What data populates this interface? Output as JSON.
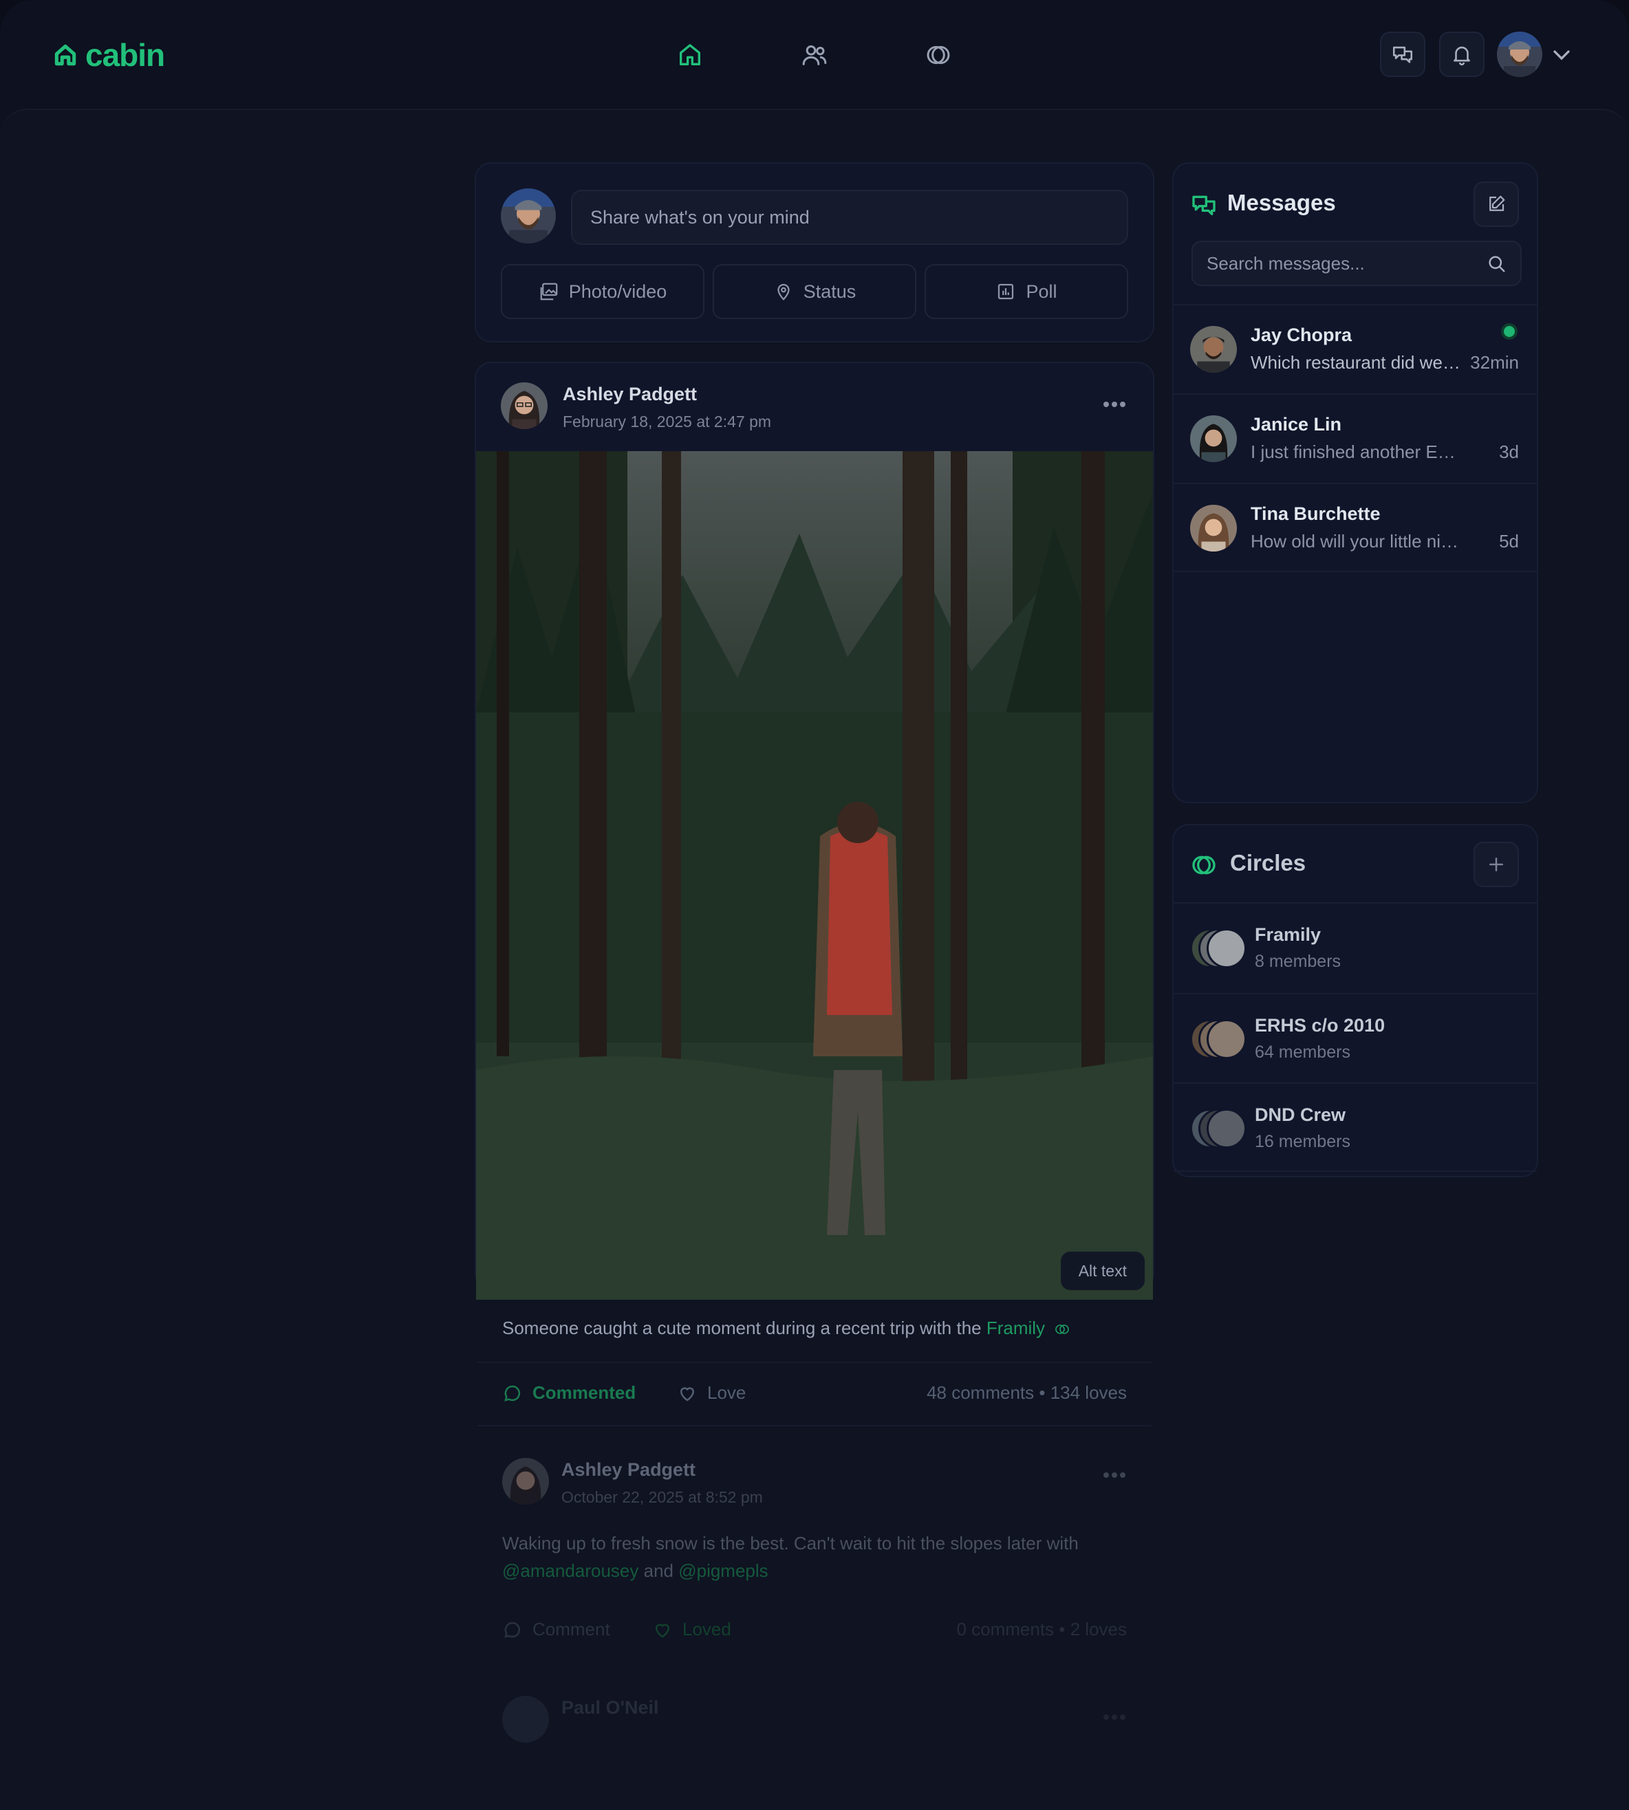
{
  "brand": {
    "name": "cabin",
    "accent": "#22c07a"
  },
  "nav": [
    {
      "icon": "home-icon",
      "active": true
    },
    {
      "icon": "friends-icon",
      "active": false
    },
    {
      "icon": "circles-icon",
      "active": false
    }
  ],
  "header_actions": [
    "chat-icon",
    "bell-icon",
    "avatar",
    "chevron-down-icon"
  ],
  "composer": {
    "placeholder": "Share what's on your mind",
    "buttons": [
      {
        "icon": "photo-icon",
        "label": "Photo/video"
      },
      {
        "icon": "location-pin-icon",
        "label": "Status"
      },
      {
        "icon": "poll-icon",
        "label": "Poll"
      }
    ]
  },
  "post": {
    "author": "Ashley Padgett",
    "date": "February 18, 2025 at 2:47 pm",
    "alt_label": "Alt text",
    "caption_before": "Someone caught a cute moment during a recent trip with the ",
    "caption_link": "Framily",
    "commented_label": "Commented",
    "love_label": "Love",
    "stats": "48 comments • 134 loves"
  },
  "post2": {
    "author": "Ashley Padgett",
    "date": "October 22, 2025 at 8:52 pm",
    "text_line1": "Waking up to fresh snow is the best. Can't wait to hit the slopes later with",
    "mention1": "@amandarousey",
    "and_word": " and ",
    "mention2": "@pigmepls",
    "comment_label": "Comment",
    "loved_label": "Loved",
    "stats": "0 comments • 2 loves"
  },
  "post3": {
    "author": "Paul O'Neil"
  },
  "messages": {
    "title": "Messages",
    "search_placeholder": "Search messages...",
    "items": [
      {
        "name": "Jay Chopra",
        "preview": "Which restaurant did we go to last time?",
        "time": "32min",
        "online": true
      },
      {
        "name": "Janice Lin",
        "preview": "I just finished another EMS shift",
        "time": "3d",
        "online": false
      },
      {
        "name": "Tina Burchette",
        "preview": "How old will your little niece be?",
        "time": "5d",
        "online": false
      }
    ]
  },
  "circles": {
    "title": "Circles",
    "items": [
      {
        "name": "Framily",
        "members": "8 members"
      },
      {
        "name": "ERHS c/o 2010",
        "members": "64 members"
      },
      {
        "name": "DND Crew",
        "members": "16 members"
      }
    ]
  }
}
